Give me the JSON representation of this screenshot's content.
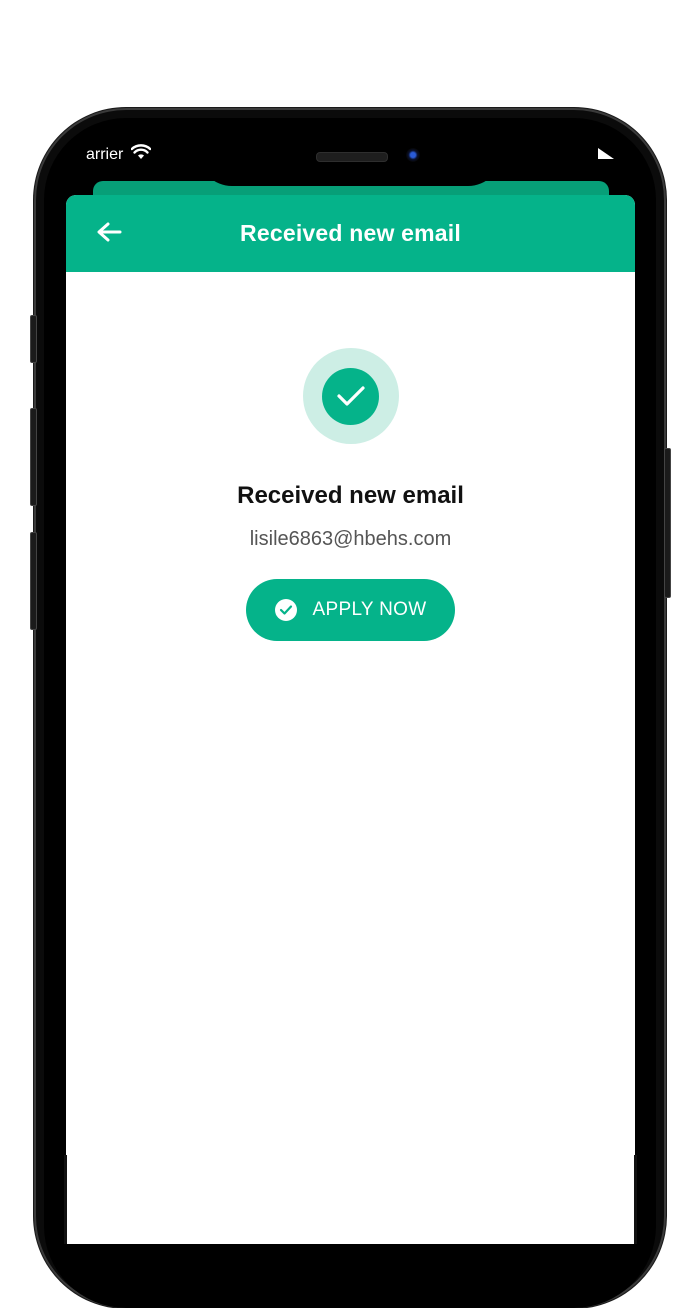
{
  "status_bar": {
    "carrier": "arrier",
    "wifi_icon": "wifi-icon",
    "battery_icon": "battery-icon"
  },
  "header": {
    "back_icon": "arrow-left-icon",
    "title": "Received new email"
  },
  "main": {
    "success_icon": "check-circle-icon",
    "heading": "Received new email",
    "email": "lisile6863@hbehs.com",
    "apply_button": {
      "icon": "check-circle-icon",
      "label": "APPLY NOW"
    }
  },
  "colors": {
    "accent": "#05b38a",
    "accent_light": "#cdeee5",
    "heading_text": "#111111",
    "muted_text": "#555555"
  }
}
